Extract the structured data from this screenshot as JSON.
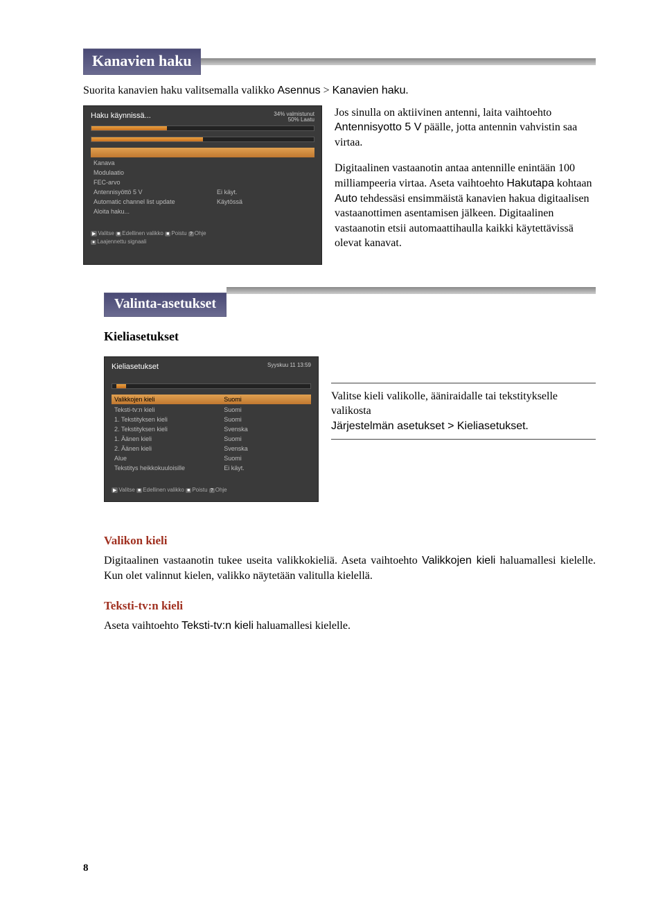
{
  "section1": {
    "title": "Kanavien haku",
    "intro_pre": "Suorita kanavien haku valitsemalla valikko ",
    "intro_menu1": "Asennus",
    "intro_gt": " > ",
    "intro_menu2": "Kanavien haku",
    "intro_post": ".",
    "para1_a": "Jos sinulla on aktiivinen antenni, laita vaihtoehto ",
    "para1_opt": "Antennisyotto 5 V",
    "para1_b": " päälle, jotta antennin vahvistin saa virtaa.",
    "para2_a": "Digitaalinen vastaanotin antaa antennille enintään 100 milliampeeria virtaa. Aseta vaihtoehto ",
    "para2_opt1": "Hakutapa",
    "para2_b": " kohtaan ",
    "para2_opt2": "Auto",
    "para2_c": " tehdessäsi ensimmäistä kanavien hakua digitaalisen vastaanottimen asentamisen jälkeen. Digitaalinen vastaanotin etsii automaattihaulla kaikki käytettävissä olevat kanavat."
  },
  "shot1": {
    "title": "Haku käynnissä...",
    "tr1": "34% valmistunut",
    "tr2": "50% Laatu",
    "fill1_pct": "34%",
    "fill2_pct": "50%",
    "rows": [
      {
        "c1": "Kanava",
        "c2": ""
      },
      {
        "c1": "Modulaatio",
        "c2": ""
      },
      {
        "c1": "FEC-arvo",
        "c2": ""
      },
      {
        "c1": "Antennisyöttö 5 V",
        "c2": "Ei käyt."
      },
      {
        "c1": "Automatic channel list update",
        "c2": "Käytössä"
      },
      {
        "c1": "Aloita haku...",
        "c2": ""
      }
    ],
    "hl": "",
    "footer_a": "Valitse",
    "footer_b": "Edellinen valikko",
    "footer_c": "Poistu",
    "footer_d": "Ohje",
    "footer2": "Laajennettu signaali"
  },
  "section2": {
    "title": "Valinta-asetukset",
    "sub": "Kieliasetukset",
    "txt_a": "Valitse kieli valikolle, ääniraidalle tai tekstitykselle valikosta",
    "txt_menu": "Järjestelmän asetukset > Kieliasetukset",
    "txt_post": "."
  },
  "shot2": {
    "title": "Kieliasetukset",
    "time": "Syyskuu 11 13:59",
    "hl": "Valikkojen kieli",
    "hl_val": "Suomi",
    "rows": [
      {
        "c1": "Teksti-tv:n kieli",
        "c2": "Suomi"
      },
      {
        "c1": "1. Tekstityksen kieli",
        "c2": "Suomi"
      },
      {
        "c1": "2. Tekstityksen kieli",
        "c2": "Svenska"
      },
      {
        "c1": "1. Äänen kieli",
        "c2": "Suomi"
      },
      {
        "c1": "2. Äänen kieli",
        "c2": "Svenska"
      },
      {
        "c1": "Alue",
        "c2": "Suomi"
      },
      {
        "c1": "Tekstitys heikkokuuloisille",
        "c2": "Ei käyt."
      }
    ],
    "footer_a": "Valitse",
    "footer_b": "Edellinen valikko",
    "footer_c": "Poistu",
    "footer_d": "Ohje"
  },
  "section3": {
    "h1": "Valikon kieli",
    "p1_a": "Digitaalinen vastaanotin tukee useita valikkokieliä. Aseta vaihtoehto ",
    "p1_opt": "Valikkojen kieli",
    "p1_b": " haluamallesi kielelle. Kun olet valinnut kielen, valikko näytetään valitulla kielellä.",
    "h2": "Teksti-tv:n kieli",
    "p2_a": "Aseta vaihtoehto ",
    "p2_opt": "Teksti-tv:n kieli",
    "p2_b": " haluamallesi kielelle."
  },
  "pagenum": "8"
}
